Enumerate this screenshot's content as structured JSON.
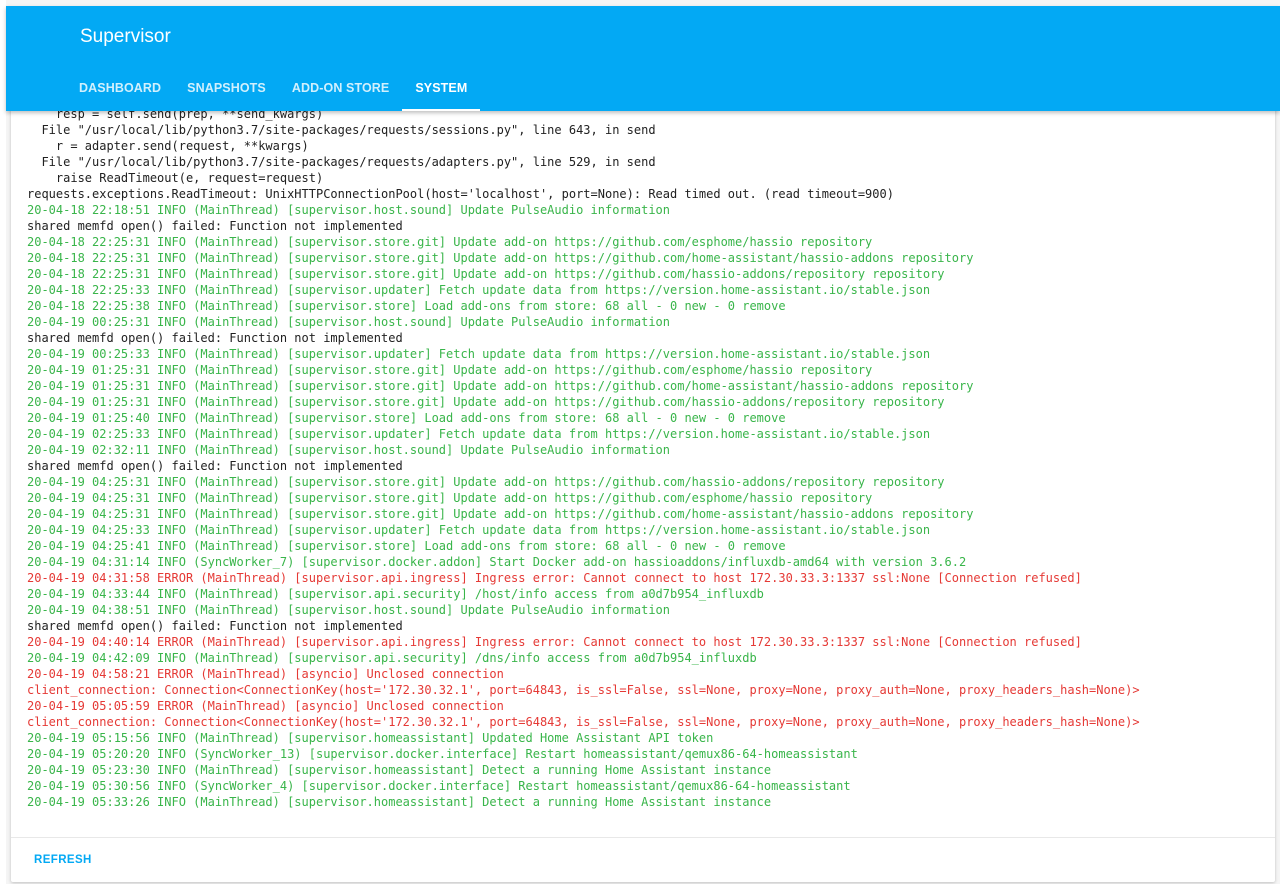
{
  "header": {
    "title": "Supervisor",
    "tabs": [
      {
        "label": "DASHBOARD",
        "active": false
      },
      {
        "label": "SNAPSHOTS",
        "active": false
      },
      {
        "label": "ADD-ON STORE",
        "active": false
      },
      {
        "label": "SYSTEM",
        "active": true
      }
    ],
    "accent_color": "#03a9f4"
  },
  "log": {
    "colors": {
      "info": "#39b54a",
      "error": "#e53935",
      "plain": "#212121"
    },
    "lines": [
      {
        "text": "    resp = self.send(prep, **send_kwargs)",
        "level": "plain"
      },
      {
        "text": "  File \"/usr/local/lib/python3.7/site-packages/requests/sessions.py\", line 643, in send",
        "level": "plain"
      },
      {
        "text": "    r = adapter.send(request, **kwargs)",
        "level": "plain"
      },
      {
        "text": "  File \"/usr/local/lib/python3.7/site-packages/requests/adapters.py\", line 529, in send",
        "level": "plain"
      },
      {
        "text": "    raise ReadTimeout(e, request=request)",
        "level": "plain"
      },
      {
        "text": "requests.exceptions.ReadTimeout: UnixHTTPConnectionPool(host='localhost', port=None): Read timed out. (read timeout=900)",
        "level": "plain"
      },
      {
        "text": "20-04-18 22:18:51 INFO (MainThread) [supervisor.host.sound] Update PulseAudio information",
        "level": "info"
      },
      {
        "text": "shared memfd open() failed: Function not implemented",
        "level": "plain"
      },
      {
        "text": "20-04-18 22:25:31 INFO (MainThread) [supervisor.store.git] Update add-on https://github.com/esphome/hassio repository",
        "level": "info"
      },
      {
        "text": "20-04-18 22:25:31 INFO (MainThread) [supervisor.store.git] Update add-on https://github.com/home-assistant/hassio-addons repository",
        "level": "info"
      },
      {
        "text": "20-04-18 22:25:31 INFO (MainThread) [supervisor.store.git] Update add-on https://github.com/hassio-addons/repository repository",
        "level": "info"
      },
      {
        "text": "20-04-18 22:25:33 INFO (MainThread) [supervisor.updater] Fetch update data from https://version.home-assistant.io/stable.json",
        "level": "info"
      },
      {
        "text": "20-04-18 22:25:38 INFO (MainThread) [supervisor.store] Load add-ons from store: 68 all - 0 new - 0 remove",
        "level": "info"
      },
      {
        "text": "20-04-19 00:25:31 INFO (MainThread) [supervisor.host.sound] Update PulseAudio information",
        "level": "info"
      },
      {
        "text": "shared memfd open() failed: Function not implemented",
        "level": "plain"
      },
      {
        "text": "20-04-19 00:25:33 INFO (MainThread) [supervisor.updater] Fetch update data from https://version.home-assistant.io/stable.json",
        "level": "info"
      },
      {
        "text": "20-04-19 01:25:31 INFO (MainThread) [supervisor.store.git] Update add-on https://github.com/esphome/hassio repository",
        "level": "info"
      },
      {
        "text": "20-04-19 01:25:31 INFO (MainThread) [supervisor.store.git] Update add-on https://github.com/home-assistant/hassio-addons repository",
        "level": "info"
      },
      {
        "text": "20-04-19 01:25:31 INFO (MainThread) [supervisor.store.git] Update add-on https://github.com/hassio-addons/repository repository",
        "level": "info"
      },
      {
        "text": "20-04-19 01:25:40 INFO (MainThread) [supervisor.store] Load add-ons from store: 68 all - 0 new - 0 remove",
        "level": "info"
      },
      {
        "text": "20-04-19 02:25:33 INFO (MainThread) [supervisor.updater] Fetch update data from https://version.home-assistant.io/stable.json",
        "level": "info"
      },
      {
        "text": "20-04-19 02:32:11 INFO (MainThread) [supervisor.host.sound] Update PulseAudio information",
        "level": "info"
      },
      {
        "text": "shared memfd open() failed: Function not implemented",
        "level": "plain"
      },
      {
        "text": "20-04-19 04:25:31 INFO (MainThread) [supervisor.store.git] Update add-on https://github.com/hassio-addons/repository repository",
        "level": "info"
      },
      {
        "text": "20-04-19 04:25:31 INFO (MainThread) [supervisor.store.git] Update add-on https://github.com/esphome/hassio repository",
        "level": "info"
      },
      {
        "text": "20-04-19 04:25:31 INFO (MainThread) [supervisor.store.git] Update add-on https://github.com/home-assistant/hassio-addons repository",
        "level": "info"
      },
      {
        "text": "20-04-19 04:25:33 INFO (MainThread) [supervisor.updater] Fetch update data from https://version.home-assistant.io/stable.json",
        "level": "info"
      },
      {
        "text": "20-04-19 04:25:41 INFO (MainThread) [supervisor.store] Load add-ons from store: 68 all - 0 new - 0 remove",
        "level": "info"
      },
      {
        "text": "20-04-19 04:31:14 INFO (SyncWorker_7) [supervisor.docker.addon] Start Docker add-on hassioaddons/influxdb-amd64 with version 3.6.2",
        "level": "info"
      },
      {
        "text": "20-04-19 04:31:58 ERROR (MainThread) [supervisor.api.ingress] Ingress error: Cannot connect to host 172.30.33.3:1337 ssl:None [Connection refused]",
        "level": "error"
      },
      {
        "text": "20-04-19 04:33:44 INFO (MainThread) [supervisor.api.security] /host/info access from a0d7b954_influxdb",
        "level": "info"
      },
      {
        "text": "20-04-19 04:38:51 INFO (MainThread) [supervisor.host.sound] Update PulseAudio information",
        "level": "info"
      },
      {
        "text": "shared memfd open() failed: Function not implemented",
        "level": "plain"
      },
      {
        "text": "20-04-19 04:40:14 ERROR (MainThread) [supervisor.api.ingress] Ingress error: Cannot connect to host 172.30.33.3:1337 ssl:None [Connection refused]",
        "level": "error"
      },
      {
        "text": "20-04-19 04:42:09 INFO (MainThread) [supervisor.api.security] /dns/info access from a0d7b954_influxdb",
        "level": "info"
      },
      {
        "text": "20-04-19 04:58:21 ERROR (MainThread) [asyncio] Unclosed connection",
        "level": "error"
      },
      {
        "text": "client_connection: Connection<ConnectionKey(host='172.30.32.1', port=64843, is_ssl=False, ssl=None, proxy=None, proxy_auth=None, proxy_headers_hash=None)>",
        "level": "error"
      },
      {
        "text": "20-04-19 05:05:59 ERROR (MainThread) [asyncio] Unclosed connection",
        "level": "error"
      },
      {
        "text": "client_connection: Connection<ConnectionKey(host='172.30.32.1', port=64843, is_ssl=False, ssl=None, proxy=None, proxy_auth=None, proxy_headers_hash=None)>",
        "level": "error"
      },
      {
        "text": "20-04-19 05:15:56 INFO (MainThread) [supervisor.homeassistant] Updated Home Assistant API token",
        "level": "info"
      },
      {
        "text": "20-04-19 05:20:20 INFO (SyncWorker_13) [supervisor.docker.interface] Restart homeassistant/qemux86-64-homeassistant",
        "level": "info"
      },
      {
        "text": "20-04-19 05:23:30 INFO (MainThread) [supervisor.homeassistant] Detect a running Home Assistant instance",
        "level": "info"
      },
      {
        "text": "20-04-19 05:30:56 INFO (SyncWorker_4) [supervisor.docker.interface] Restart homeassistant/qemux86-64-homeassistant",
        "level": "info"
      },
      {
        "text": "20-04-19 05:33:26 INFO (MainThread) [supervisor.homeassistant] Detect a running Home Assistant instance",
        "level": "info"
      }
    ]
  },
  "actions": {
    "refresh_label": "REFRESH"
  }
}
